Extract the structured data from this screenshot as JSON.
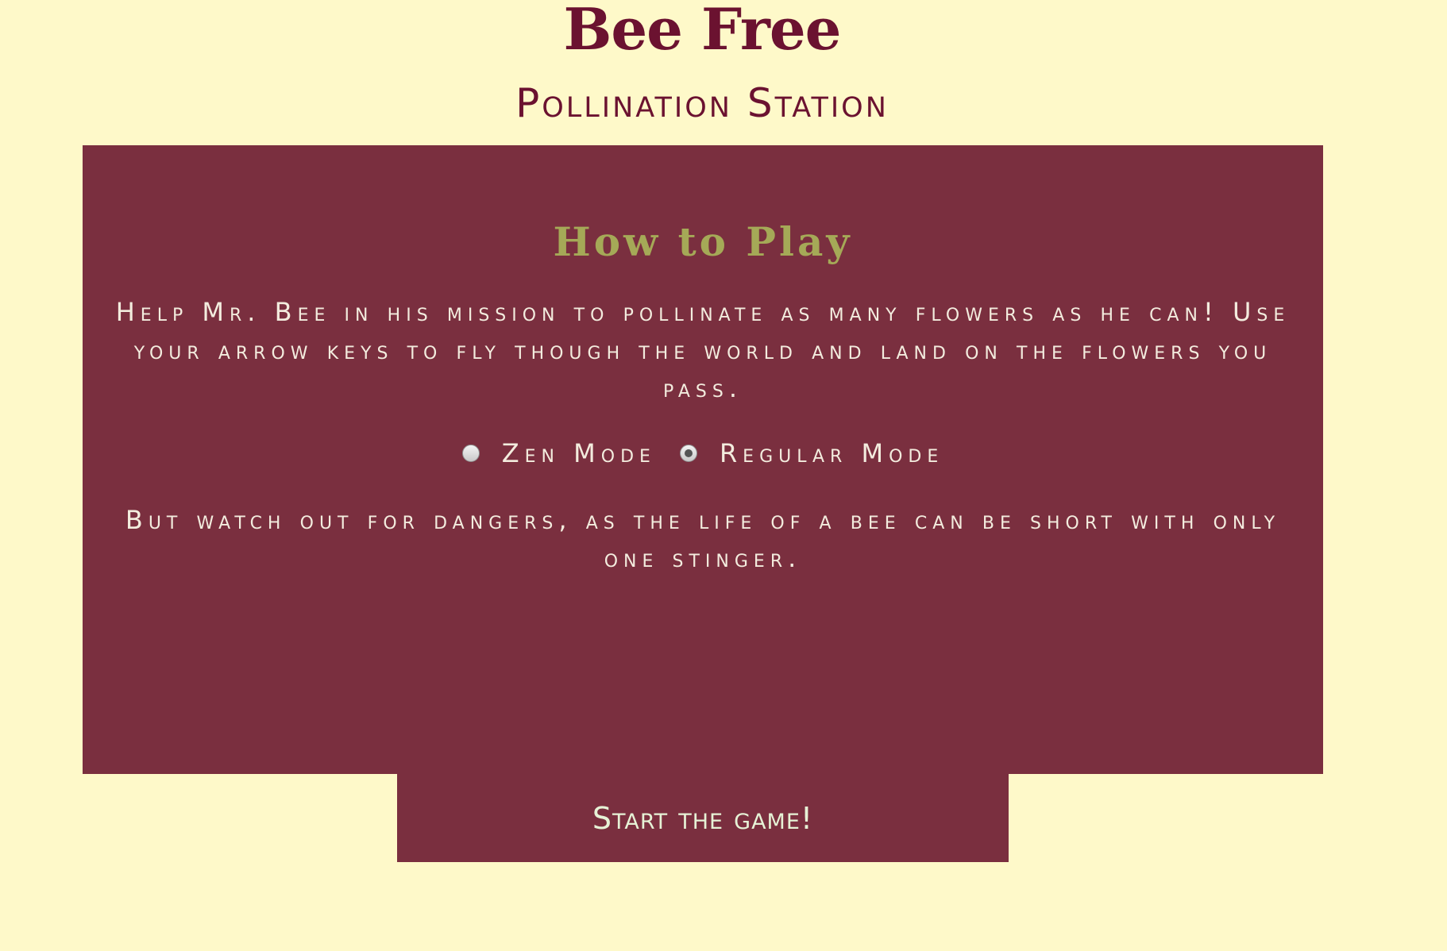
{
  "header": {
    "title": "Bee Free",
    "subtitle": "Pollination Station"
  },
  "panel": {
    "heading": "How to Play",
    "intro": "Help Mr. Bee in his mission to pollinate as many flowers as he can! Use your arrow keys to fly though the world and land on the flowers you pass.",
    "modes": [
      {
        "label": "Zen Mode",
        "selected": false
      },
      {
        "label": "Regular Mode",
        "selected": true
      }
    ],
    "warning": "But watch out for dangers, as the life of a bee can be short with only one stinger."
  },
  "start_button": {
    "label": "Start the game!"
  },
  "colors": {
    "background": "#fef9c9",
    "panel": "#7a2f3f",
    "title": "#6b1230",
    "heading": "#a5a957",
    "panel_text": "#f3ecde",
    "button_text": "#e6f2d6"
  }
}
